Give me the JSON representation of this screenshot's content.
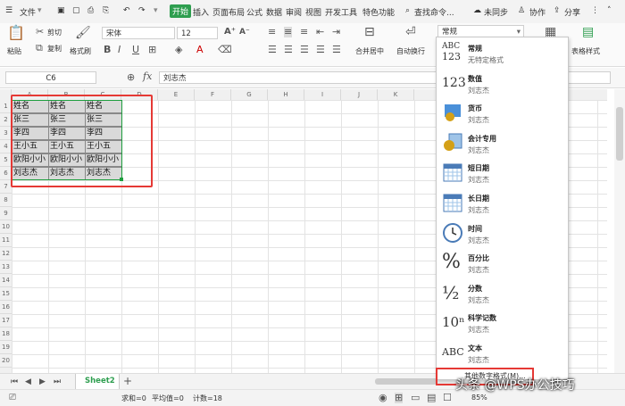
{
  "menubar": {
    "file": "文件",
    "kai": "开始",
    "tabs": [
      "插入",
      "页面布局",
      "公式",
      "数据",
      "审阅",
      "视图",
      "开发工具",
      "特色功能"
    ],
    "search": "查找命令...",
    "sync": "未同步",
    "collab": "协作",
    "share": "分享"
  },
  "ribbon": {
    "cut": "剪切",
    "copy": "复制",
    "format_painter": "格式刷",
    "paste": "粘贴",
    "font_name": "宋体",
    "font_size": "12",
    "number_format": "常规",
    "merge_center": "合并居中",
    "wrap": "自动换行",
    "table_style": "表格样式"
  },
  "formula_bar": {
    "cell_ref": "C6",
    "fx": "fx",
    "value": "刘志杰"
  },
  "columns": [
    "A",
    "B",
    "C",
    "D",
    "E",
    "F",
    "G",
    "H",
    "I",
    "J",
    "K"
  ],
  "rows": [
    "1",
    "2",
    "3",
    "4",
    "5",
    "6",
    "7",
    "8",
    "9",
    "10",
    "11",
    "12",
    "13",
    "14",
    "15",
    "16",
    "17",
    "18",
    "19",
    "20"
  ],
  "cells": [
    [
      "姓名",
      "姓名",
      "姓名"
    ],
    [
      "张三",
      "张三",
      "张三"
    ],
    [
      "李四",
      "李四",
      "李四"
    ],
    [
      "王小五",
      "王小五",
      "王小五"
    ],
    [
      "欧阳小小",
      "欧阳小小",
      "欧阳小小"
    ],
    [
      "刘志杰",
      "刘志杰",
      "刘志杰"
    ]
  ],
  "sheet_tab": "Sheet2",
  "status": {
    "sum": "求和=0",
    "avg": "平均值=0",
    "count": "计数=18",
    "zoom": "85%"
  },
  "format_menu": [
    {
      "icon": "ABC 123",
      "name": "常规",
      "example": "无特定格式"
    },
    {
      "icon": "123",
      "name": "数值",
      "example": "刘志杰"
    },
    {
      "icon": "currency",
      "name": "货币",
      "example": "刘志杰"
    },
    {
      "icon": "accounting",
      "name": "会计专用",
      "example": "刘志杰"
    },
    {
      "icon": "calendar",
      "name": "短日期",
      "example": "刘志杰"
    },
    {
      "icon": "calendar",
      "name": "长日期",
      "example": "刘志杰"
    },
    {
      "icon": "clock",
      "name": "时间",
      "example": "刘志杰"
    },
    {
      "icon": "%",
      "name": "百分比",
      "example": "刘志杰"
    },
    {
      "icon": "½",
      "name": "分数",
      "example": "刘志杰"
    },
    {
      "icon": "10ⁿ",
      "name": "科学记数",
      "example": "刘志杰"
    },
    {
      "icon": "ABC",
      "name": "文本",
      "example": "刘志杰"
    }
  ],
  "format_menu_more": "其他数字格式(M)...",
  "watermark": "头条 @WPS办公技巧",
  "colors": {
    "accent": "#2e9e4f",
    "highlight": "#e53935",
    "selection": "#1e9e3e"
  }
}
